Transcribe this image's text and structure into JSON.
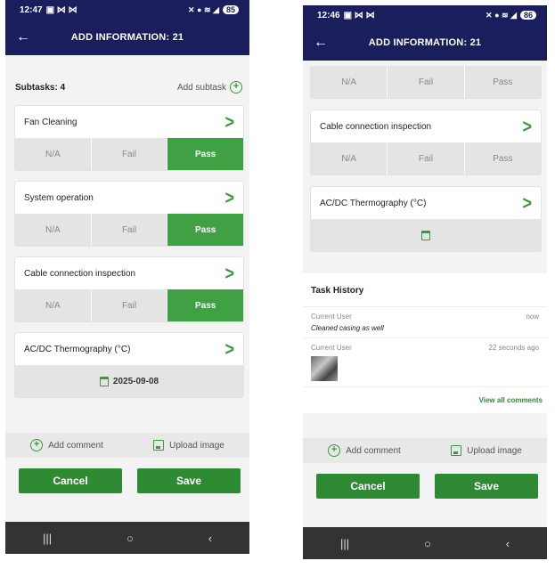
{
  "left": {
    "status": {
      "time": "12:47",
      "battery": "85"
    },
    "appbar": {
      "title": "ADD INFORMATION: 21"
    },
    "subtasks_label": "Subtasks: 4",
    "add_subtask_label": "Add subtask",
    "tasks": [
      {
        "name": "Fan Cleaning",
        "options": [
          "N/A",
          "Fail",
          "Pass"
        ],
        "selected": "Pass"
      },
      {
        "name": "System operation",
        "options": [
          "N/A",
          "Fail",
          "Pass"
        ],
        "selected": "Pass"
      },
      {
        "name": "Cable connection inspection",
        "options": [
          "N/A",
          "Fail",
          "Pass"
        ],
        "selected": "Pass"
      }
    ],
    "thermography": {
      "name": "AC/DC Thermography (°C)",
      "date": "2025-09-08"
    },
    "actions": {
      "add_comment": "Add comment",
      "upload_image": "Upload image"
    },
    "buttons": {
      "cancel": "Cancel",
      "save": "Save"
    }
  },
  "right": {
    "status": {
      "time": "12:46",
      "battery": "86"
    },
    "appbar": {
      "title": "ADD INFORMATION: 21"
    },
    "partial_task": {
      "options": [
        "N/A",
        "Fail",
        "Pass"
      ]
    },
    "task": {
      "name": "Cable connection inspection",
      "options": [
        "N/A",
        "Fail",
        "Pass"
      ]
    },
    "thermography": {
      "name": "AC/DC Thermography (°C)"
    },
    "history": {
      "title": "Task History",
      "entries": [
        {
          "user": "Current User",
          "time": "now",
          "comment": "Cleaned casing as well"
        },
        {
          "user": "Current User",
          "time": "22 seconds ago"
        }
      ],
      "view_all": "View all comments"
    },
    "actions": {
      "add_comment": "Add comment",
      "upload_image": "Upload image"
    },
    "buttons": {
      "cancel": "Cancel",
      "save": "Save"
    }
  },
  "colors": {
    "header": "#1b1e5c",
    "accent": "#3fa144",
    "button": "#2f8a34"
  }
}
